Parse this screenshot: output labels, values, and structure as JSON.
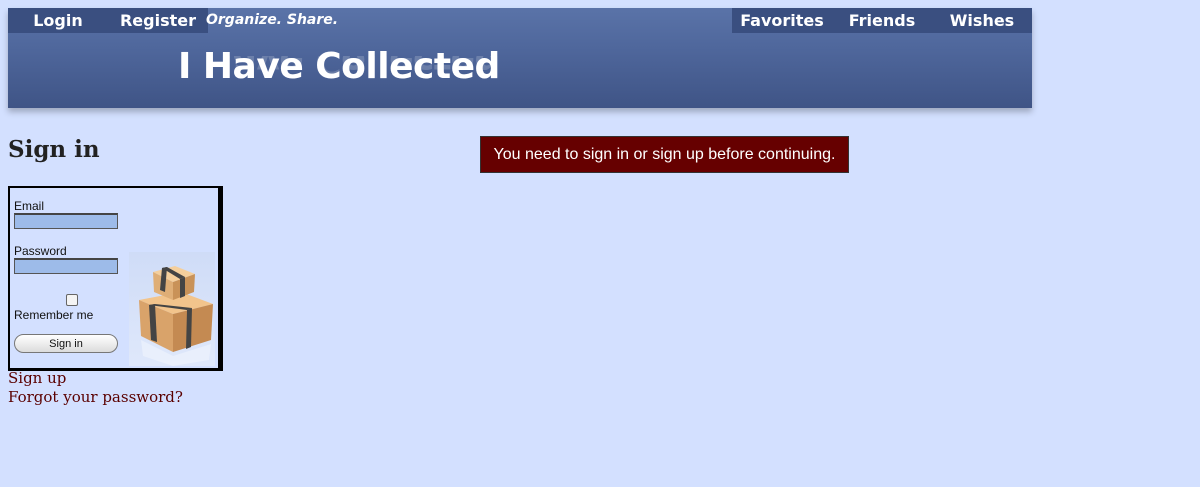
{
  "nav": {
    "login": "Login",
    "register": "Register",
    "favorites": "Favorites",
    "friends": "Friends",
    "wishes": "Wishes"
  },
  "header": {
    "tagline": "Organize. Share.",
    "logo": "I Have Collected"
  },
  "page_title": "Sign in",
  "flash_message": "You need to sign in or sign up before continuing.",
  "form": {
    "email_label": "Email",
    "email_value": "",
    "password_label": "Password",
    "password_value": "",
    "remember_label": "Remember me",
    "remember_checked": false,
    "submit_label": "Sign in"
  },
  "links": {
    "signup": "Sign up",
    "forgot_password": "Forgot your password?"
  },
  "colors": {
    "background": "#d3e0ff",
    "header": "#4f679c",
    "flash": "#660000",
    "link": "#5a0000"
  }
}
